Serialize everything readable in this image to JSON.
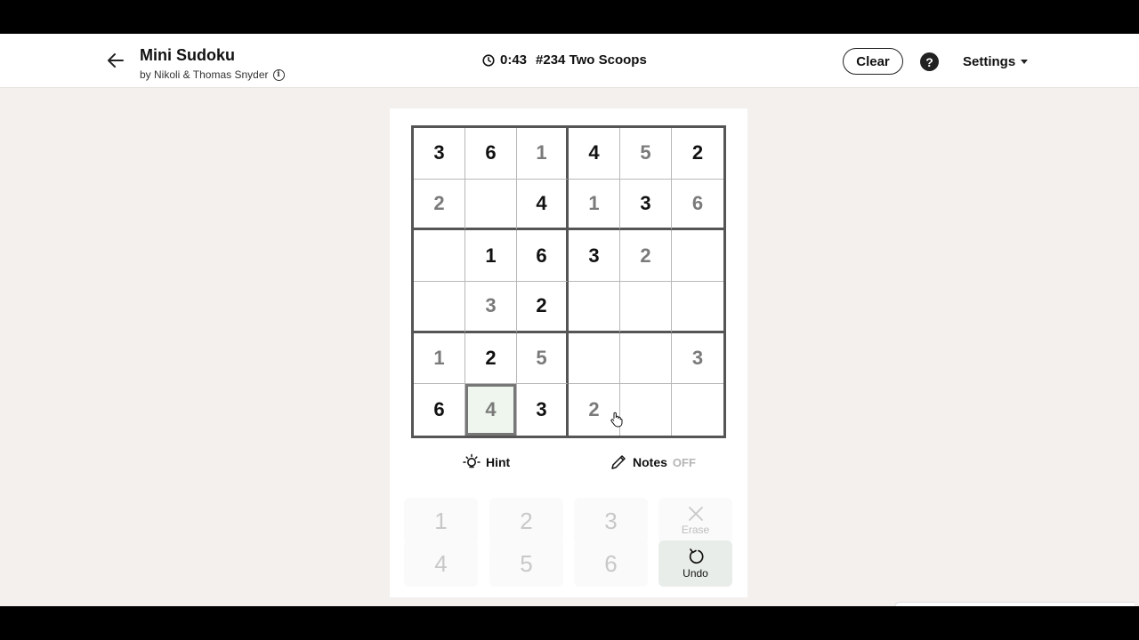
{
  "header": {
    "title": "Mini Sudoku",
    "byline": "by Nikoli & Thomas Snyder",
    "timer": "0:43",
    "puzzle": "#234 Two Scoops",
    "clear_label": "Clear",
    "help_label": "?",
    "settings_label": "Settings"
  },
  "board": {
    "rows": [
      [
        {
          "v": "3",
          "t": "given"
        },
        {
          "v": "6",
          "t": "given"
        },
        {
          "v": "1",
          "t": "user"
        },
        {
          "v": "4",
          "t": "given"
        },
        {
          "v": "5",
          "t": "user"
        },
        {
          "v": "2",
          "t": "given"
        }
      ],
      [
        {
          "v": "2",
          "t": "user"
        },
        {
          "v": "",
          "t": "empty"
        },
        {
          "v": "4",
          "t": "given"
        },
        {
          "v": "1",
          "t": "user"
        },
        {
          "v": "3",
          "t": "given"
        },
        {
          "v": "6",
          "t": "user"
        }
      ],
      [
        {
          "v": "",
          "t": "empty"
        },
        {
          "v": "1",
          "t": "given"
        },
        {
          "v": "6",
          "t": "given"
        },
        {
          "v": "3",
          "t": "given"
        },
        {
          "v": "2",
          "t": "user"
        },
        {
          "v": "",
          "t": "empty"
        }
      ],
      [
        {
          "v": "",
          "t": "empty"
        },
        {
          "v": "3",
          "t": "user"
        },
        {
          "v": "2",
          "t": "given"
        },
        {
          "v": "",
          "t": "empty"
        },
        {
          "v": "",
          "t": "empty"
        },
        {
          "v": "",
          "t": "empty"
        }
      ],
      [
        {
          "v": "1",
          "t": "user"
        },
        {
          "v": "2",
          "t": "given"
        },
        {
          "v": "5",
          "t": "user"
        },
        {
          "v": "",
          "t": "empty"
        },
        {
          "v": "",
          "t": "empty"
        },
        {
          "v": "3",
          "t": "user"
        }
      ],
      [
        {
          "v": "6",
          "t": "given"
        },
        {
          "v": "4",
          "t": "user",
          "selected": true
        },
        {
          "v": "3",
          "t": "given"
        },
        {
          "v": "2",
          "t": "user"
        },
        {
          "v": "",
          "t": "empty"
        },
        {
          "v": "",
          "t": "empty"
        }
      ]
    ]
  },
  "tools": {
    "hint_label": "Hint",
    "notes_label": "Notes",
    "notes_state": "OFF"
  },
  "keypad": {
    "keys": [
      "1",
      "2",
      "3",
      "4",
      "5",
      "6"
    ],
    "erase_label": "Erase",
    "undo_label": "Undo"
  },
  "colors": {
    "given": "#111111",
    "user": "#7a7a7a",
    "selected_bg": "#eef6ee",
    "background": "#f3f0ed"
  }
}
